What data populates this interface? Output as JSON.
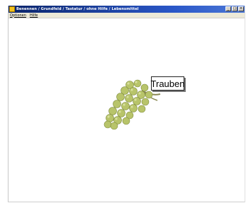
{
  "window": {
    "title": "Benennen / Grundfeld / Tastatur / ohne Hilfe / Lebensmittel"
  },
  "menu": {
    "items": [
      "Optionen",
      "Hilfe"
    ]
  },
  "picture": {
    "object_icon": "grapes-image",
    "label": "Trauben"
  }
}
